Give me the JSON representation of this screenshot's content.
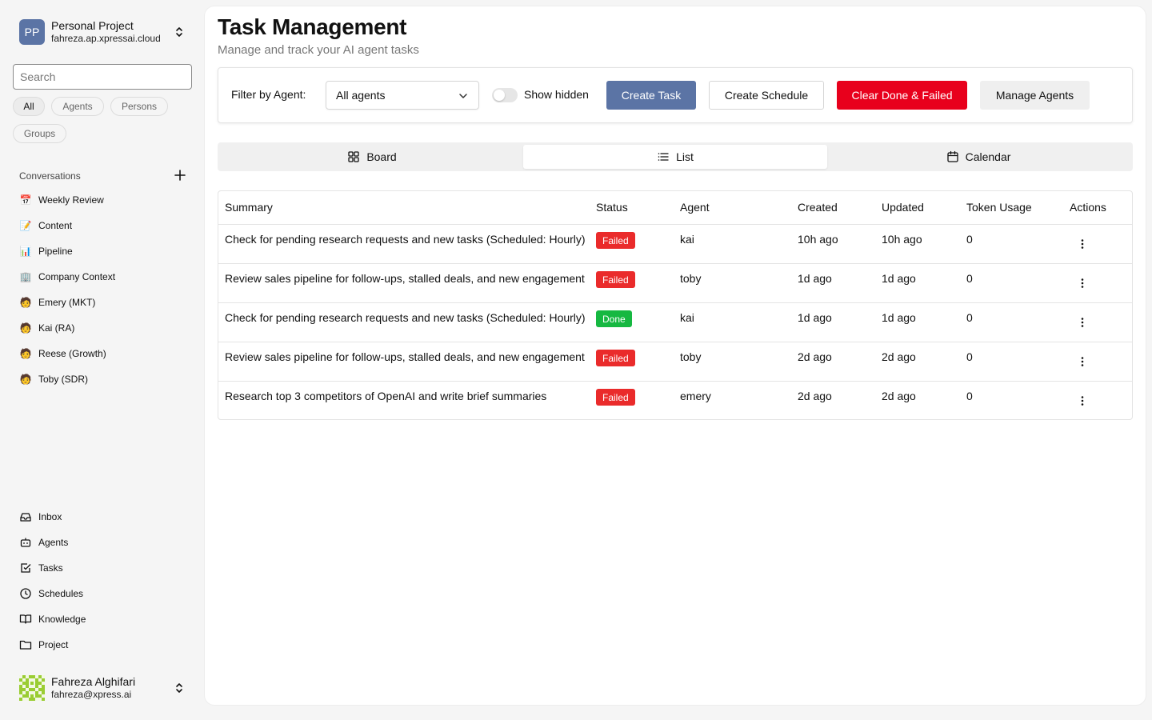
{
  "sidebar": {
    "project": {
      "initials": "PP",
      "name": "Personal Project",
      "email": "fahreza.ap.xpressai.cloud"
    },
    "search_placeholder": "Search",
    "filters": [
      "All",
      "Agents",
      "Persons",
      "Groups"
    ],
    "conversations_label": "Conversations",
    "conversations": [
      {
        "label": "Weekly Review",
        "icon": "📅"
      },
      {
        "label": "Content",
        "icon": "📝"
      },
      {
        "label": "Pipeline",
        "icon": "📊"
      },
      {
        "label": "Company Context",
        "icon": "🏢"
      },
      {
        "label": "Emery (MKT)",
        "icon": "🧑"
      },
      {
        "label": "Kai (RA)",
        "icon": "🧑"
      },
      {
        "label": "Reese (Growth)",
        "icon": "🧑"
      },
      {
        "label": "Toby (SDR)",
        "icon": "🧑"
      }
    ],
    "nav": [
      {
        "label": "Inbox",
        "icon": "inbox-icon"
      },
      {
        "label": "Agents",
        "icon": "bot-icon"
      },
      {
        "label": "Tasks",
        "icon": "check-square-icon"
      },
      {
        "label": "Schedules",
        "icon": "clock-icon"
      },
      {
        "label": "Knowledge",
        "icon": "book-icon"
      },
      {
        "label": "Project",
        "icon": "folder-icon"
      }
    ],
    "user": {
      "name": "Fahreza Alghifari",
      "email": "fahreza@xpress.ai"
    }
  },
  "main": {
    "title": "Task Management",
    "subtitle": "Manage and track your AI agent tasks",
    "filter_label": "Filter by Agent:",
    "filter_value": "All agents",
    "show_hidden_label": "Show hidden",
    "buttons": {
      "create_task": "Create Task",
      "create_schedule": "Create Schedule",
      "clear": "Clear Done & Failed",
      "manage": "Manage Agents"
    },
    "tabs": [
      "Board",
      "List",
      "Calendar"
    ],
    "active_tab": "List",
    "table": {
      "headers": [
        "Summary",
        "Status",
        "Agent",
        "Created",
        "Updated",
        "Token Usage",
        "Actions"
      ],
      "rows": [
        {
          "summary": "Check for pending research requests and new tasks (Scheduled: Hourly)",
          "status": "Failed",
          "agent": "kai",
          "created": "10h ago",
          "updated": "10h ago",
          "tokens": "0"
        },
        {
          "summary": "Review sales pipeline for follow-ups, stalled deals, and new engagement",
          "status": "Failed",
          "agent": "toby",
          "created": "1d ago",
          "updated": "1d ago",
          "tokens": "0"
        },
        {
          "summary": "Check for pending research requests and new tasks (Scheduled: Hourly)",
          "status": "Done",
          "agent": "kai",
          "created": "1d ago",
          "updated": "1d ago",
          "tokens": "0"
        },
        {
          "summary": "Review sales pipeline for follow-ups, stalled deals, and new engagement",
          "status": "Failed",
          "agent": "toby",
          "created": "2d ago",
          "updated": "2d ago",
          "tokens": "0"
        },
        {
          "summary": "Research top 3 competitors of OpenAI and write brief summaries",
          "status": "Failed",
          "agent": "emery",
          "created": "2d ago",
          "updated": "2d ago",
          "tokens": "0"
        }
      ]
    }
  },
  "colors": {
    "accent": "#5b74a5",
    "danger": "#e8001c",
    "failed": "#ea2b2b",
    "done": "#16b841"
  }
}
